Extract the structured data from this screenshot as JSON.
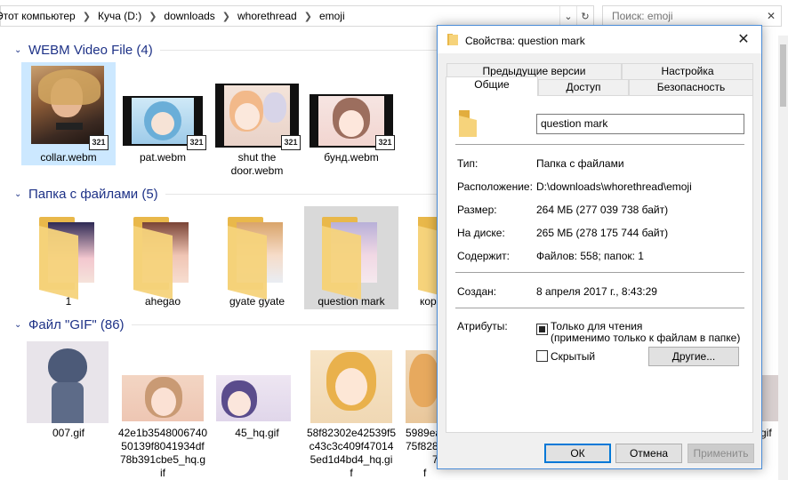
{
  "address": {
    "crumbs": [
      "Этот компьютер",
      "Куча (D:)",
      "downloads",
      "whorethread",
      "emoji"
    ],
    "search_placeholder": "Поиск: emoji"
  },
  "groups": {
    "webm": {
      "title": "WEBM Video File (4)",
      "items": [
        {
          "name": "collar.webm"
        },
        {
          "name": "pat.webm"
        },
        {
          "name_lines": [
            "shut the",
            "door.webm"
          ]
        },
        {
          "name": "бунд.webm"
        }
      ],
      "badge": "321"
    },
    "folders": {
      "title": "Папка с файлами (5)",
      "items": [
        {
          "name": "1"
        },
        {
          "name": "ahegao"
        },
        {
          "name": "gyate gyate"
        },
        {
          "name": "question mark"
        },
        {
          "name": "кор"
        }
      ]
    },
    "gif": {
      "title": "Файл \"GIF\" (86)",
      "items": [
        {
          "name_lines": [
            "007.gif"
          ]
        },
        {
          "name_lines": [
            "42e1b3548006740",
            "50139f8041934df",
            "78b391cbe5_hq.g",
            "if"
          ]
        },
        {
          "name_lines": [
            "45_hq.gif"
          ]
        },
        {
          "name_lines": [
            "58f82302e42539f5",
            "c43c3c409f47014",
            "5ed1d4bd4_hq.gi",
            "f"
          ]
        },
        {
          "name_lines": [
            "5989ea",
            "75f828",
            "7",
            "f"
          ]
        },
        {
          "name_lines": [
            "gif"
          ]
        }
      ]
    }
  },
  "dialog": {
    "title": "Свойства: question mark",
    "tabs_top": [
      "Предыдущие версии",
      "Настройка"
    ],
    "tabs_bottom": [
      "Общие",
      "Доступ",
      "Безопасность"
    ],
    "name_value": "question mark",
    "rows": [
      {
        "label": "Тип:",
        "value": "Папка с файлами"
      },
      {
        "label": "Расположение:",
        "value": "D:\\downloads\\whorethread\\emoji"
      },
      {
        "label": "Размер:",
        "value": "264 МБ (277 039 738 байт)"
      },
      {
        "label": "На диске:",
        "value": "265 МБ (278 175 744 байт)"
      },
      {
        "label": "Содержит:",
        "value": "Файлов: 558; папок: 1"
      }
    ],
    "created_label": "Создан:",
    "created_value": "8 апреля 2017 г., 8:43:29",
    "attr_label": "Атрибуты:",
    "readonly_line1": "Только для чтения",
    "readonly_line2": "(применимо только к файлам в папке)",
    "hidden_label": "Скрытый",
    "other_button": "Другие...",
    "ok": "ОК",
    "cancel": "Отмена",
    "apply": "Применить"
  },
  "colors": {
    "accent": "#0078d7",
    "group_title": "#1e3287",
    "selection": "#cce8ff",
    "folder": "#f0c64e"
  }
}
